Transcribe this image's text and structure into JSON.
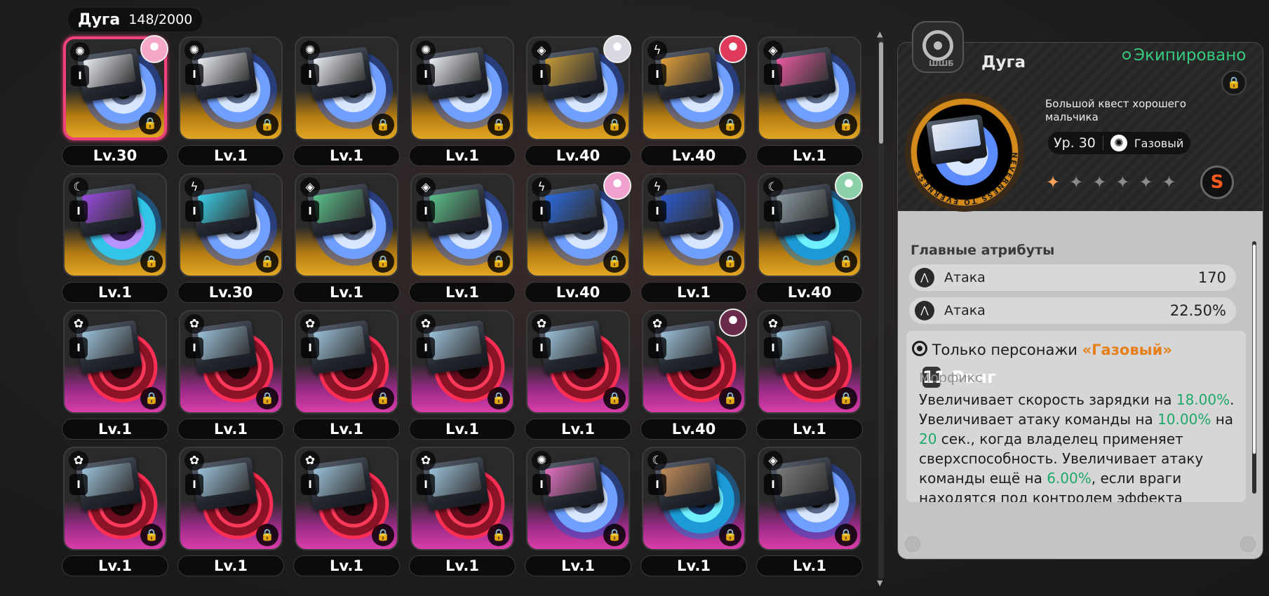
{
  "header": {
    "title": "Дуга",
    "count": "148/2000"
  },
  "cards": [
    {
      "level": "Lv.30",
      "style": "gold",
      "disc": "blue",
      "element": "gas-icon",
      "element_glyph": "✺",
      "art": "#e9ecf2",
      "avatar": "#f6a6c6",
      "selected": true
    },
    {
      "level": "Lv.1",
      "style": "gold",
      "disc": "blue",
      "element": "gas-icon",
      "element_glyph": "✺",
      "art": "#e9ecf2"
    },
    {
      "level": "Lv.1",
      "style": "gold",
      "disc": "blue",
      "element": "gas-icon",
      "element_glyph": "✺",
      "art": "#e9ecf2"
    },
    {
      "level": "Lv.1",
      "style": "gold",
      "disc": "blue",
      "element": "gas-icon",
      "element_glyph": "✺",
      "art": "#e9ecf2"
    },
    {
      "level": "Lv.40",
      "style": "gold",
      "disc": "blue",
      "element": "cube-icon",
      "element_glyph": "◈",
      "art": "#c49a3a",
      "avatar": "#d8d8e0"
    },
    {
      "level": "Lv.40",
      "style": "gold",
      "disc": "blue",
      "element": "lightning-icon",
      "element_glyph": "ϟ",
      "art": "#e2a03a",
      "avatar": "#e03a5a"
    },
    {
      "level": "Lv.1",
      "style": "gold",
      "disc": "blue",
      "element": "cube-icon",
      "element_glyph": "◈",
      "art": "#e85aa0"
    },
    {
      "level": "Lv.1",
      "style": "gold",
      "disc": "violet",
      "element": "moon-icon",
      "element_glyph": "☾",
      "art": "#9a4ae0"
    },
    {
      "level": "Lv.30",
      "style": "gold",
      "disc": "blue",
      "element": "lightning-icon",
      "element_glyph": "ϟ",
      "art": "#3ad0e8"
    },
    {
      "level": "Lv.1",
      "style": "gold",
      "disc": "blue",
      "element": "cube-icon",
      "element_glyph": "◈",
      "art": "#5ac08a"
    },
    {
      "level": "Lv.1",
      "style": "gold",
      "disc": "blue",
      "element": "cube-icon",
      "element_glyph": "◈",
      "art": "#5ac08a"
    },
    {
      "level": "Lv.40",
      "style": "gold",
      "disc": "blue",
      "element": "lightning-icon",
      "element_glyph": "ϟ",
      "art": "#2a6ae0",
      "avatar": "#f2a0d0"
    },
    {
      "level": "Lv.1",
      "style": "gold",
      "disc": "blue",
      "element": "lightning-icon",
      "element_glyph": "ϟ",
      "art": "#2a5ad0"
    },
    {
      "level": "Lv.40",
      "style": "gold",
      "disc": "cyan",
      "element": "moon-icon",
      "element_glyph": "☾",
      "art": "#8a9aa0",
      "avatar": "#8ad0a8"
    },
    {
      "level": "Lv.1",
      "style": "pink",
      "disc": "red",
      "element": "flower-icon",
      "element_glyph": "✿",
      "art": "#9ac0d8"
    },
    {
      "level": "Lv.1",
      "style": "pink",
      "disc": "red",
      "element": "flower-icon",
      "element_glyph": "✿",
      "art": "#9ac0d8"
    },
    {
      "level": "Lv.1",
      "style": "pink",
      "disc": "red",
      "element": "flower-icon",
      "element_glyph": "✿",
      "art": "#9ac0d8"
    },
    {
      "level": "Lv.1",
      "style": "pink",
      "disc": "red",
      "element": "flower-icon",
      "element_glyph": "✿",
      "art": "#9ac0d8"
    },
    {
      "level": "Lv.1",
      "style": "pink",
      "disc": "red",
      "element": "flower-icon",
      "element_glyph": "✿",
      "art": "#9ac0d8"
    },
    {
      "level": "Lv.40",
      "style": "pink",
      "disc": "red",
      "element": "flower-icon",
      "element_glyph": "✿",
      "art": "#9ac0d8",
      "avatar": "#6a2a4a"
    },
    {
      "level": "Lv.1",
      "style": "pink",
      "disc": "red",
      "element": "flower-icon",
      "element_glyph": "✿",
      "art": "#9ac0d8"
    },
    {
      "level": "Lv.1",
      "style": "pink",
      "disc": "red",
      "element": "flower-icon",
      "element_glyph": "✿",
      "art": "#9ac0d8"
    },
    {
      "level": "Lv.1",
      "style": "pink",
      "disc": "red",
      "element": "flower-icon",
      "element_glyph": "✿",
      "art": "#9ac0d8"
    },
    {
      "level": "Lv.1",
      "style": "pink",
      "disc": "red",
      "element": "flower-icon",
      "element_glyph": "✿",
      "art": "#9ac0d8"
    },
    {
      "level": "Lv.1",
      "style": "pink",
      "disc": "red",
      "element": "flower-icon",
      "element_glyph": "✿",
      "art": "#9ac0d8"
    },
    {
      "level": "Lv.1",
      "style": "pink",
      "disc": "blue",
      "element": "gas-icon",
      "element_glyph": "✺",
      "art": "#e070c0"
    },
    {
      "level": "Lv.1",
      "style": "pink",
      "disc": "cyan",
      "element": "moon-icon",
      "element_glyph": "☾",
      "art": "#c08a5a"
    },
    {
      "level": "Lv.1",
      "style": "pink",
      "disc": "blue",
      "element": "cube-icon",
      "element_glyph": "◈",
      "art": "#7a7a7a"
    }
  ],
  "panel": {
    "title": "Дуга",
    "equipped": "Экипировано",
    "tape_label": "ШШБ",
    "medal_text": "NEVERNESS TO EVERNESS",
    "track_name": "Большой квест хорошего мальчика",
    "level": "Ур. 30",
    "element": "Газовый",
    "stars_total": 6,
    "stars_lit": 1,
    "badge": "S",
    "attributes_title": "Главные атрибуты",
    "attributes": [
      {
        "name": "Атака",
        "value": "170"
      },
      {
        "name": "Атака",
        "value": "22.50%"
      }
    ],
    "skill": {
      "rank": "11 Ранг",
      "restriction": "Только персонажи",
      "restriction_element": "«Газовый»",
      "name": "Морфикс",
      "t1": "Увеличивает скорость зарядки на ",
      "v1": "18.00%",
      "t2": ". Увеличивает атаку команды на ",
      "v2": "10.00%",
      "t3": " на ",
      "v3": "20",
      "t4": " сек., когда владелец применяет сверхспособность. Увеличивает атаку команды ещё на ",
      "v4": "6.00%",
      "t5": ", если враги находятся под контролем эффекта"
    }
  },
  "colors": {
    "accent_green": "#37c97e",
    "accent_orange": "#e5801b",
    "select_pink": "#f0427a"
  }
}
